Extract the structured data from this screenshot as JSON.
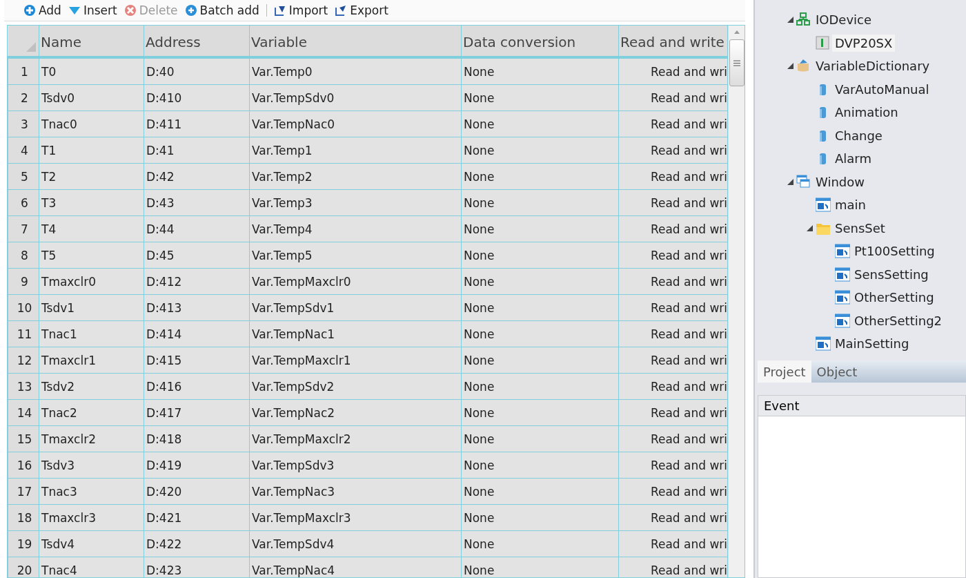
{
  "toolbar": [
    {
      "label": "Add",
      "kind": "add",
      "disabled": false
    },
    {
      "label": "Insert",
      "kind": "insert",
      "disabled": false
    },
    {
      "label": "Delete",
      "kind": "delete",
      "disabled": true
    },
    {
      "label": "Batch add",
      "kind": "batch",
      "disabled": false
    },
    {
      "label": "Import",
      "kind": "import",
      "disabled": false
    },
    {
      "label": "Export",
      "kind": "export",
      "disabled": false
    }
  ],
  "table": {
    "columns": [
      "",
      "Name",
      "Address",
      "Variable",
      "Data conversion",
      "Read and write"
    ],
    "rows": [
      [
        "1",
        "T0",
        "D:40",
        "Var.Temp0",
        "None",
        "Read and wri"
      ],
      [
        "2",
        "Tsdv0",
        "D:410",
        "Var.TempSdv0",
        "None",
        "Read and wri"
      ],
      [
        "3",
        "Tnac0",
        "D:411",
        "Var.TempNac0",
        "None",
        "Read and wri"
      ],
      [
        "4",
        "T1",
        "D:41",
        "Var.Temp1",
        "None",
        "Read and wri"
      ],
      [
        "5",
        "T2",
        "D:42",
        "Var.Temp2",
        "None",
        "Read and wri"
      ],
      [
        "6",
        "T3",
        "D:43",
        "Var.Temp3",
        "None",
        "Read and wri"
      ],
      [
        "7",
        "T4",
        "D:44",
        "Var.Temp4",
        "None",
        "Read and wri"
      ],
      [
        "8",
        "T5",
        "D:45",
        "Var.Temp5",
        "None",
        "Read and wri"
      ],
      [
        "9",
        "Tmaxclr0",
        "D:412",
        "Var.TempMaxclr0",
        "None",
        "Read and wri"
      ],
      [
        "10",
        "Tsdv1",
        "D:413",
        "Var.TempSdv1",
        "None",
        "Read and wri"
      ],
      [
        "11",
        "Tnac1",
        "D:414",
        "Var.TempNac1",
        "None",
        "Read and wri"
      ],
      [
        "12",
        "Tmaxclr1",
        "D:415",
        "Var.TempMaxclr1",
        "None",
        "Read and wri"
      ],
      [
        "13",
        "Tsdv2",
        "D:416",
        "Var.TempSdv2",
        "None",
        "Read and wri"
      ],
      [
        "14",
        "Tnac2",
        "D:417",
        "Var.TempNac2",
        "None",
        "Read and wri"
      ],
      [
        "15",
        "Tmaxclr2",
        "D:418",
        "Var.TempMaxclr2",
        "None",
        "Read and wri"
      ],
      [
        "16",
        "Tsdv3",
        "D:419",
        "Var.TempSdv3",
        "None",
        "Read and wri"
      ],
      [
        "17",
        "Tnac3",
        "D:420",
        "Var.TempNac3",
        "None",
        "Read and wri"
      ],
      [
        "18",
        "Tmaxclr3",
        "D:421",
        "Var.TempMaxclr3",
        "None",
        "Read and wri"
      ],
      [
        "19",
        "Tsdv4",
        "D:422",
        "Var.TempSdv4",
        "None",
        "Read and wri"
      ],
      [
        "20",
        "Tnac4",
        "D:423",
        "Var.TempNac4",
        "None",
        "Read and wri"
      ]
    ]
  },
  "tree": [
    {
      "label": "IODevice",
      "kind": "network",
      "expanded": true,
      "selected": false,
      "children": [
        {
          "label": "DVP20SX",
          "kind": "device",
          "selected": true
        }
      ]
    },
    {
      "label": "VariableDictionary",
      "kind": "dictionary",
      "expanded": true,
      "selected": false,
      "children": [
        {
          "label": "VarAutoManual",
          "kind": "variable",
          "selected": false
        },
        {
          "label": "Animation",
          "kind": "variable",
          "selected": false
        },
        {
          "label": "Change",
          "kind": "variable",
          "selected": false
        },
        {
          "label": "Alarm",
          "kind": "variable",
          "selected": false
        }
      ]
    },
    {
      "label": "Window",
      "kind": "windows",
      "expanded": true,
      "selected": false,
      "children": [
        {
          "label": "main",
          "kind": "window",
          "selected": false
        },
        {
          "label": "SensSet",
          "kind": "folder",
          "expanded": true,
          "selected": false,
          "children": [
            {
              "label": "Pt100Setting",
              "kind": "window",
              "selected": false
            },
            {
              "label": "SensSetting",
              "kind": "window",
              "selected": false
            },
            {
              "label": "OtherSetting",
              "kind": "window",
              "selected": false
            },
            {
              "label": "OtherSetting2",
              "kind": "window",
              "selected": false
            }
          ]
        },
        {
          "label": "MainSetting",
          "kind": "window",
          "selected": false
        }
      ]
    }
  ],
  "panel_tabs": [
    {
      "label": "Project",
      "selected": true
    },
    {
      "label": "Object",
      "selected": false
    }
  ],
  "event_panel": {
    "title": "Event"
  }
}
